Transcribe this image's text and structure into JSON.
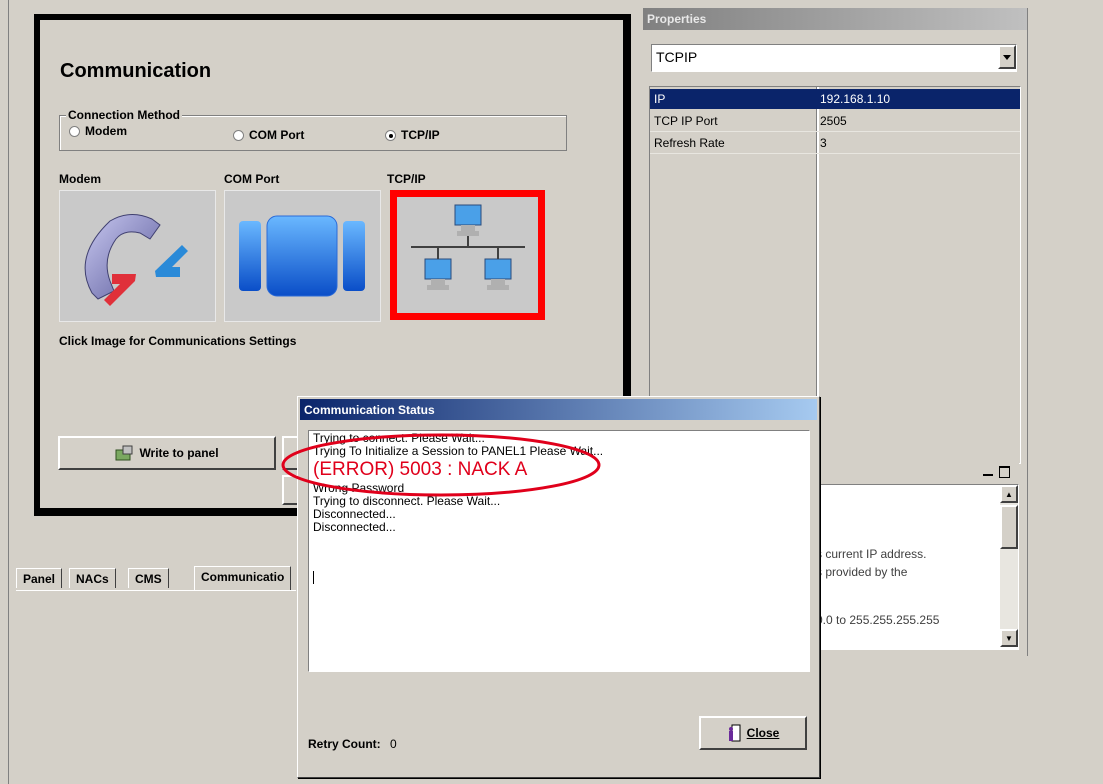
{
  "comm_panel": {
    "title": "Communication",
    "group_label": "Connection Method",
    "radios": [
      {
        "label": "Modem",
        "checked": false
      },
      {
        "label": "COM Port",
        "checked": false
      },
      {
        "label": "TCP/IP",
        "checked": true
      }
    ],
    "image_labels": [
      "Modem",
      "COM Port",
      "TCP/IP"
    ],
    "hint": "Click Image for Communications Settings",
    "write_button": "Write to panel"
  },
  "tabs": [
    "Panel",
    "NACs",
    "CMS",
    "Communicatio"
  ],
  "properties": {
    "title": "Properties",
    "selector_value": "TCPIP",
    "rows": [
      {
        "key": "IP",
        "value": "192.168.1.10",
        "selected": true
      },
      {
        "key": "TCP IP Port",
        "value": "2505",
        "selected": false
      },
      {
        "key": "Refresh Rate",
        "value": "3",
        "selected": false
      }
    ]
  },
  "help_panel": {
    "lines": [
      "s current IP address.",
      "s provided by the",
      "0.0 to 255.255.255.255"
    ]
  },
  "status_dialog": {
    "title": "Communication Status",
    "log": [
      "Trying to connect. Please Wait...",
      "Trying To Initialize a Session to PANEL1 Please Wait...",
      "(ERROR) 5003 : NACK A",
      "Wrong Password",
      "Trying to disconnect. Please Wait...",
      "Disconnected...",
      "Disconnected..."
    ],
    "retry_label": "Retry Count:",
    "retry_value": "0",
    "close_button": "Close"
  },
  "colors": {
    "face": "#d4d0c8",
    "title_active": "#0a246a",
    "title_grad_end": "#a6caf0",
    "selection": "#0a246a",
    "error_red": "#e0001b",
    "highlight_border": "#ff0000"
  }
}
